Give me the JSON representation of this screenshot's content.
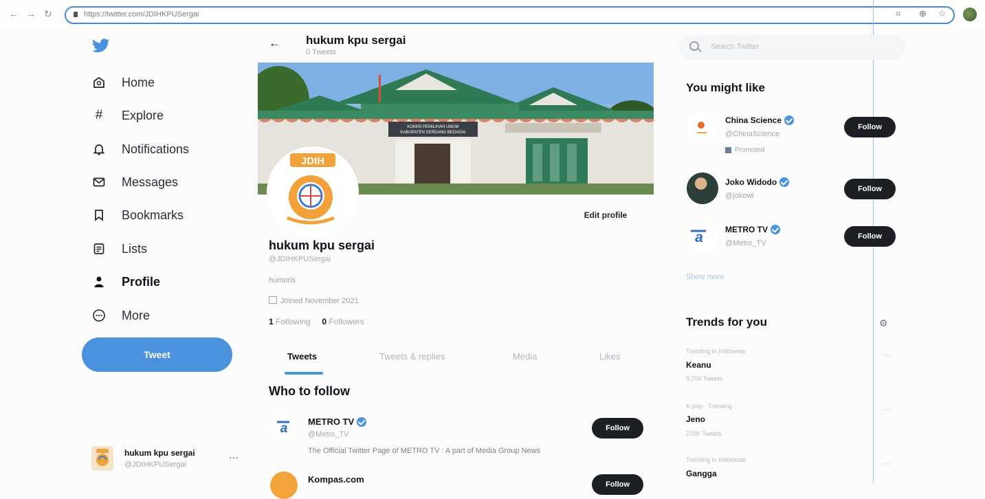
{
  "browser": {
    "url": "https://twitter.com/JDIHKPUSergai"
  },
  "nav": {
    "items": [
      {
        "label": "Home"
      },
      {
        "label": "Explore"
      },
      {
        "label": "Notifications"
      },
      {
        "label": "Messages"
      },
      {
        "label": "Bookmarks"
      },
      {
        "label": "Lists"
      },
      {
        "label": "Profile"
      },
      {
        "label": "More"
      }
    ],
    "tweet_label": "Tweet"
  },
  "account": {
    "name": "hukum kpu sergai",
    "handle": "@JDIHKPUSergai",
    "dots": "···"
  },
  "header": {
    "back": "←",
    "name": "hukum kpu sergai",
    "tweet_count": "0 Tweets"
  },
  "banner": {
    "sign_line1": "KOMISI PEMILIHAN UMUM",
    "sign_line2": "KABUPATEN SERDANG BEDAGAI"
  },
  "avatar": {
    "label": "JDIH"
  },
  "profile": {
    "edit_label": "Edit profile",
    "name": "hukum kpu sergai",
    "handle": "@JDIHKPUSergai",
    "bio": "humoris",
    "joined": "Joined November 2021",
    "following_count": "1",
    "following_label": "Following",
    "followers_count": "0",
    "followers_label": "Followers"
  },
  "tabs": [
    {
      "label": "Tweets"
    },
    {
      "label": "Tweets & replies"
    },
    {
      "label": "Media"
    },
    {
      "label": "Likes"
    }
  ],
  "who_to_follow": {
    "title": "Who to follow",
    "items": [
      {
        "name": "METRO TV",
        "handle": "@Metro_TV",
        "desc": "The Official Twitter Page of METRO TV : A part of Media Group News",
        "follow": "Follow"
      },
      {
        "name": "Kompas.com",
        "follow": "Follow"
      }
    ]
  },
  "search": {
    "placeholder": "Search Twitter"
  },
  "you_might_like": {
    "title": "You might like",
    "items": [
      {
        "name": "China Science",
        "handle": "@ChinaScience",
        "promoted": "Promoted",
        "follow": "Follow"
      },
      {
        "name": "Joko Widodo",
        "handle": "@jokowi",
        "follow": "Follow"
      },
      {
        "name": "METRO TV",
        "handle": "@Metro_TV",
        "follow": "Follow"
      }
    ],
    "show_more": "Show more"
  },
  "trends": {
    "title": "Trends for you",
    "items": [
      {
        "meta": "Trending in Indonesia",
        "name": "Keanu",
        "count": "9,700 Tweets"
      },
      {
        "meta": "K-pop · Trending",
        "name": "Jeno",
        "count": "270K Tweets"
      },
      {
        "meta": "Trending in Indonesia",
        "name": "Gangga"
      }
    ],
    "dots": "···"
  },
  "colors": {
    "accent": "#4a91de",
    "follow_bg": "#1c1f23",
    "url_border": "#4a86d8"
  }
}
